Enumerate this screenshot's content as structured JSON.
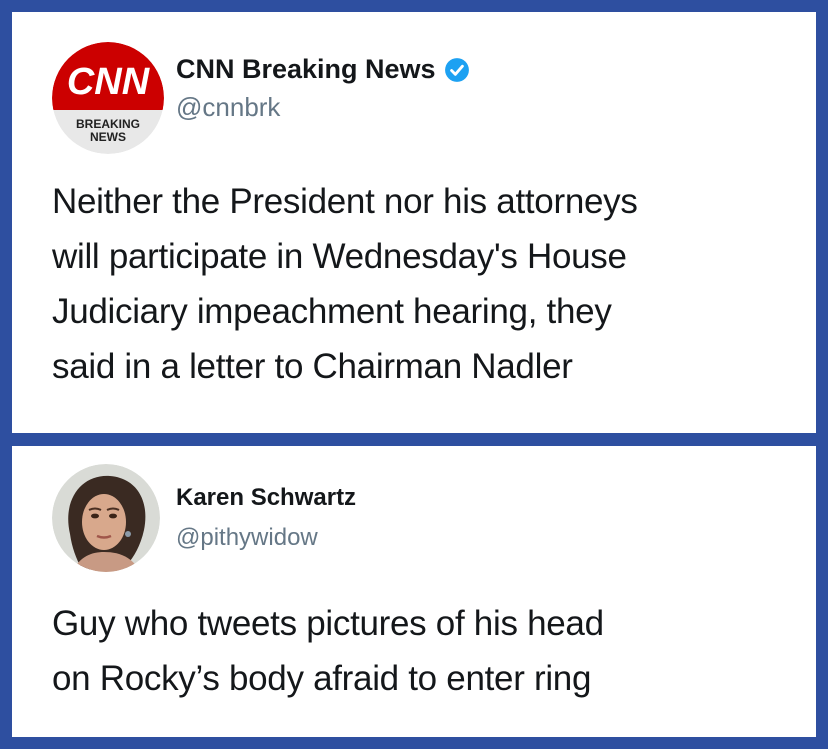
{
  "tweets": [
    {
      "name": "CNN Breaking News",
      "handle": "@cnnbrk",
      "verified": true,
      "avatar_logo_text": "CNN",
      "avatar_badge_line1": "BREAKING",
      "avatar_badge_line2": "NEWS",
      "text_lines": [
        "Neither the President nor his attorneys",
        "will participate in Wednesday's House",
        "Judiciary impeachment hearing, they",
        "said in a letter to Chairman Nadler"
      ]
    },
    {
      "name": "Karen Schwartz",
      "handle": "@pithywidow",
      "verified": false,
      "text_lines": [
        "Guy who tweets pictures of his head",
        "on Rocky’s body afraid to enter ring"
      ]
    }
  ],
  "colors": {
    "frame_blue": "#2e4fa0",
    "cnn_red": "#cc0000",
    "verified_blue": "#1da1f2",
    "handle_gray": "#657786",
    "text_dark": "#14171a"
  },
  "icons": {
    "verified": "verified-badge-icon",
    "avatar1": "cnn-breaking-news-logo",
    "avatar2": "profile-photo"
  }
}
